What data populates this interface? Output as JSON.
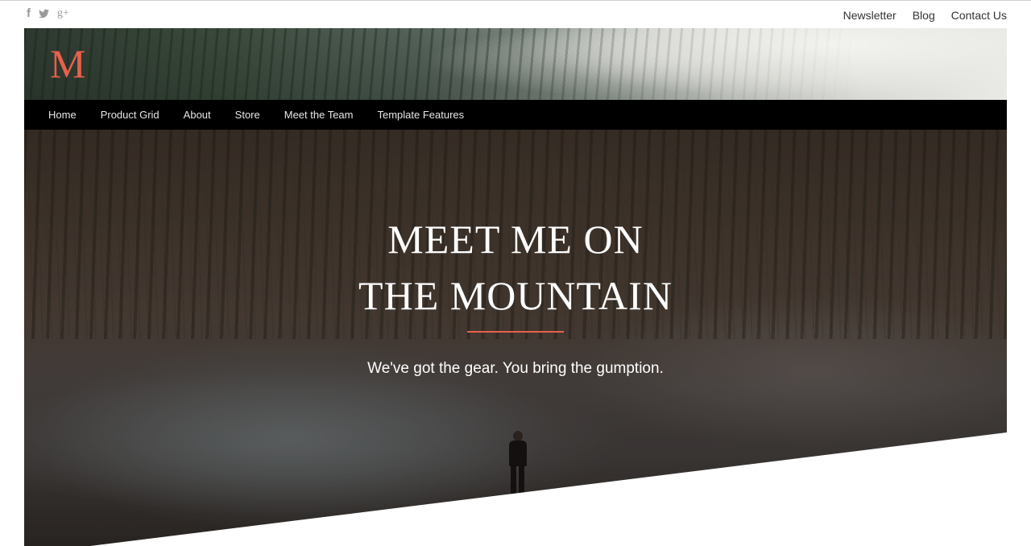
{
  "social": {
    "facebook": "f",
    "twitter": "t",
    "googleplus": "g+"
  },
  "utility_nav": [
    "Newsletter",
    "Blog",
    "Contact Us"
  ],
  "logo": {
    "letter": "M"
  },
  "nav": [
    "Home",
    "Product Grid",
    "About",
    "Store",
    "Meet the Team",
    "Template Features"
  ],
  "hero": {
    "title_line1": "MEET ME ON",
    "title_line2": "THE MOUNTAIN",
    "tagline": "We've got the gear. You bring the gumption."
  },
  "colors": {
    "accent": "#e8614c",
    "nav_bg": "#000000",
    "text_light": "#ffffff"
  }
}
